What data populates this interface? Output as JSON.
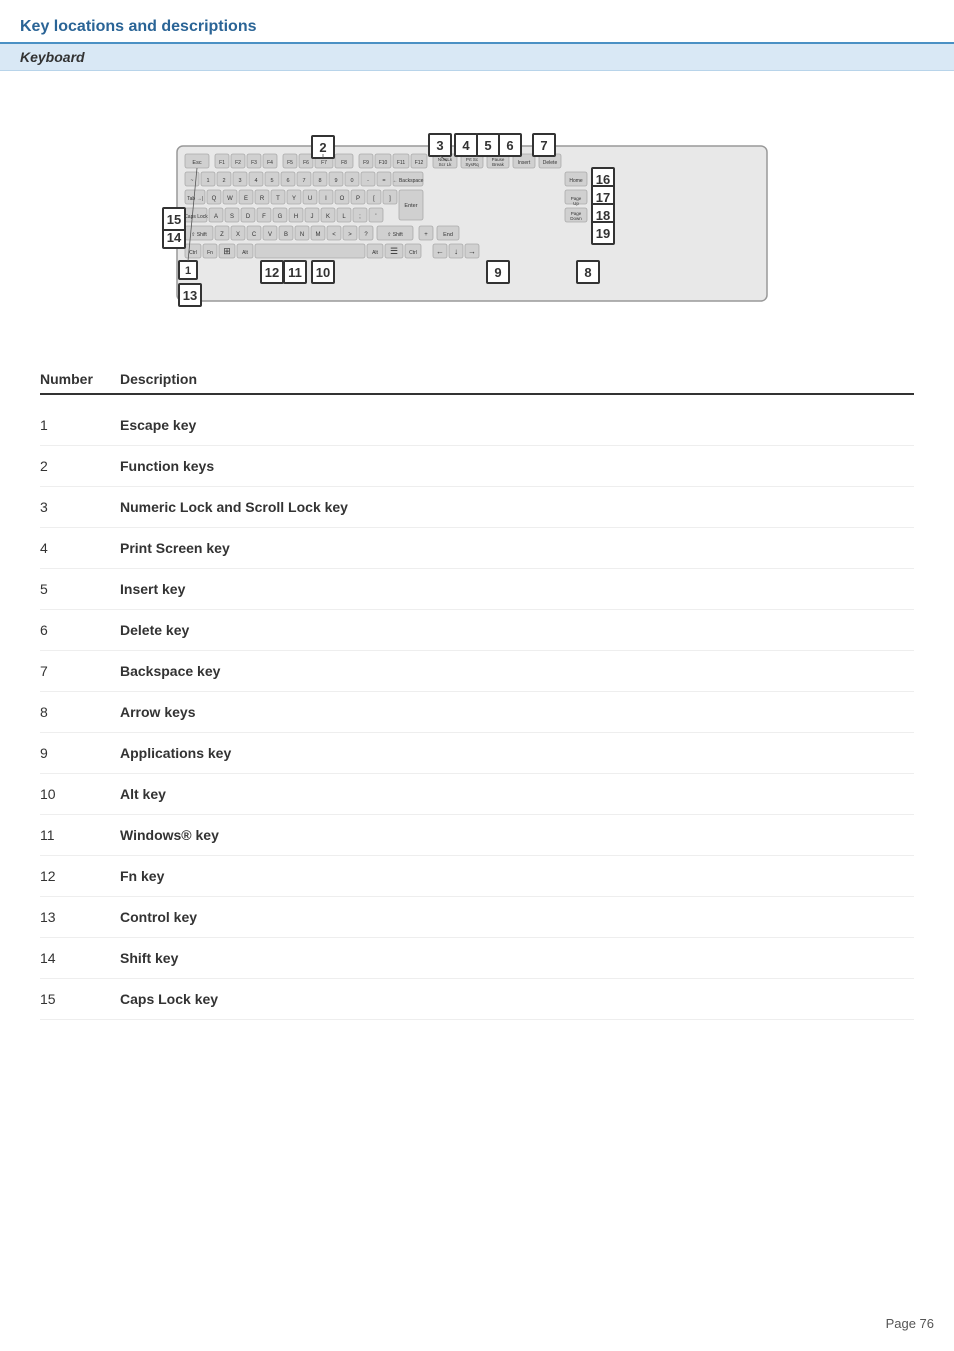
{
  "header": {
    "title": "Key locations and descriptions",
    "section": "Keyboard"
  },
  "table": {
    "col1": "Number",
    "col2": "Description",
    "rows": [
      {
        "number": "1",
        "description": "Escape key"
      },
      {
        "number": "2",
        "description": "Function keys"
      },
      {
        "number": "3",
        "description": "Numeric Lock and Scroll Lock key"
      },
      {
        "number": "4",
        "description": "Print Screen key"
      },
      {
        "number": "5",
        "description": "Insert key"
      },
      {
        "number": "6",
        "description": "Delete key"
      },
      {
        "number": "7",
        "description": "Backspace key"
      },
      {
        "number": "8",
        "description": "Arrow keys"
      },
      {
        "number": "9",
        "description": "Applications key"
      },
      {
        "number": "10",
        "description": "Alt key"
      },
      {
        "number": "11",
        "description": "Windows® key"
      },
      {
        "number": "12",
        "description": "Fn key"
      },
      {
        "number": "13",
        "description": "Control key"
      },
      {
        "number": "14",
        "description": "Shift key"
      },
      {
        "number": "15",
        "description": "Caps Lock key"
      }
    ]
  },
  "page": {
    "number": "Page 76"
  }
}
